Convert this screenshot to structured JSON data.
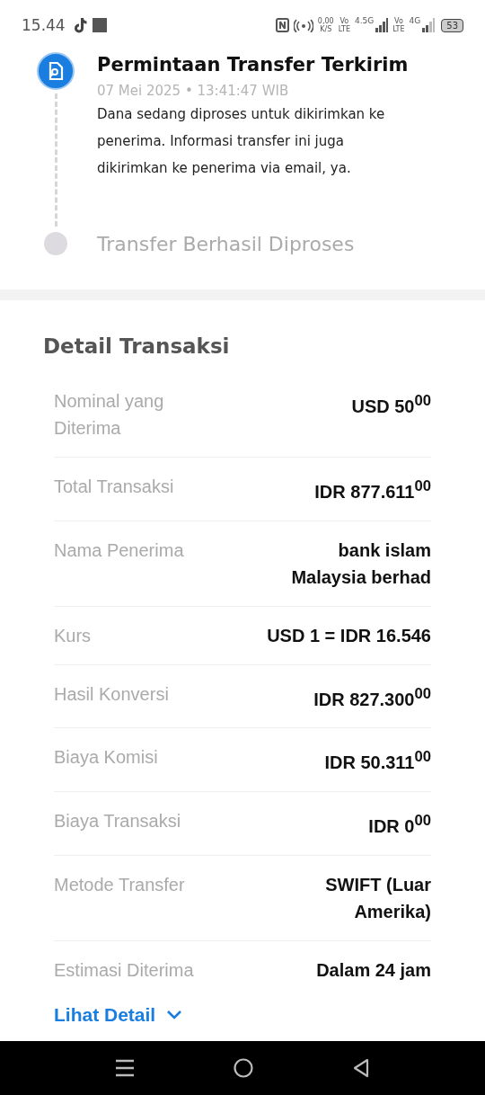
{
  "status_bar": {
    "time": "15.44",
    "speed_value": "0,00",
    "speed_unit": "K/S",
    "sim1_top": "Vo",
    "sim1_bottom": "LTE",
    "sim1_network": "4.5G",
    "sim2_top": "Vo",
    "sim2_bottom": "LTE",
    "sim2_network": "4G",
    "battery": "53"
  },
  "timeline": [
    {
      "title": "Permintaan Transfer Terkirim",
      "active": true,
      "timestamp": "07 Mei 2025 • 13:41:47 WIB",
      "description": "Dana sedang diproses untuk dikirimkan ke penerima. Informasi transfer ini juga dikirimkan ke penerima via email, ya."
    },
    {
      "title": "Transfer Berhasil Diproses",
      "active": false
    }
  ],
  "details": {
    "title": "Detail Transaksi",
    "rows": [
      {
        "label": "Nominal yang Diterima",
        "value": "USD 50$^{00}$"
      },
      {
        "label": "Total Transaksi",
        "value": "IDR 877.611$^{00}$"
      },
      {
        "label": "Nama Penerima",
        "value": "bank islam Malaysia berhad"
      },
      {
        "label": "Kurs",
        "value": "USD 1 = IDR 16.546"
      },
      {
        "label": "Hasil Konversi",
        "value": "IDR 827.300$^{00}$"
      },
      {
        "label": "Biaya Komisi",
        "value": "IDR 50.311$^{00}$"
      },
      {
        "label": "Biaya Transaksi",
        "value": "IDR 0$^{00}$"
      },
      {
        "label": "Metode Transfer",
        "value": "SWIFT (Luar Amerika)"
      },
      {
        "label": "Estimasi Diterima",
        "value": "Dalam 24 jam"
      }
    ],
    "link": "Lihat Detail"
  }
}
